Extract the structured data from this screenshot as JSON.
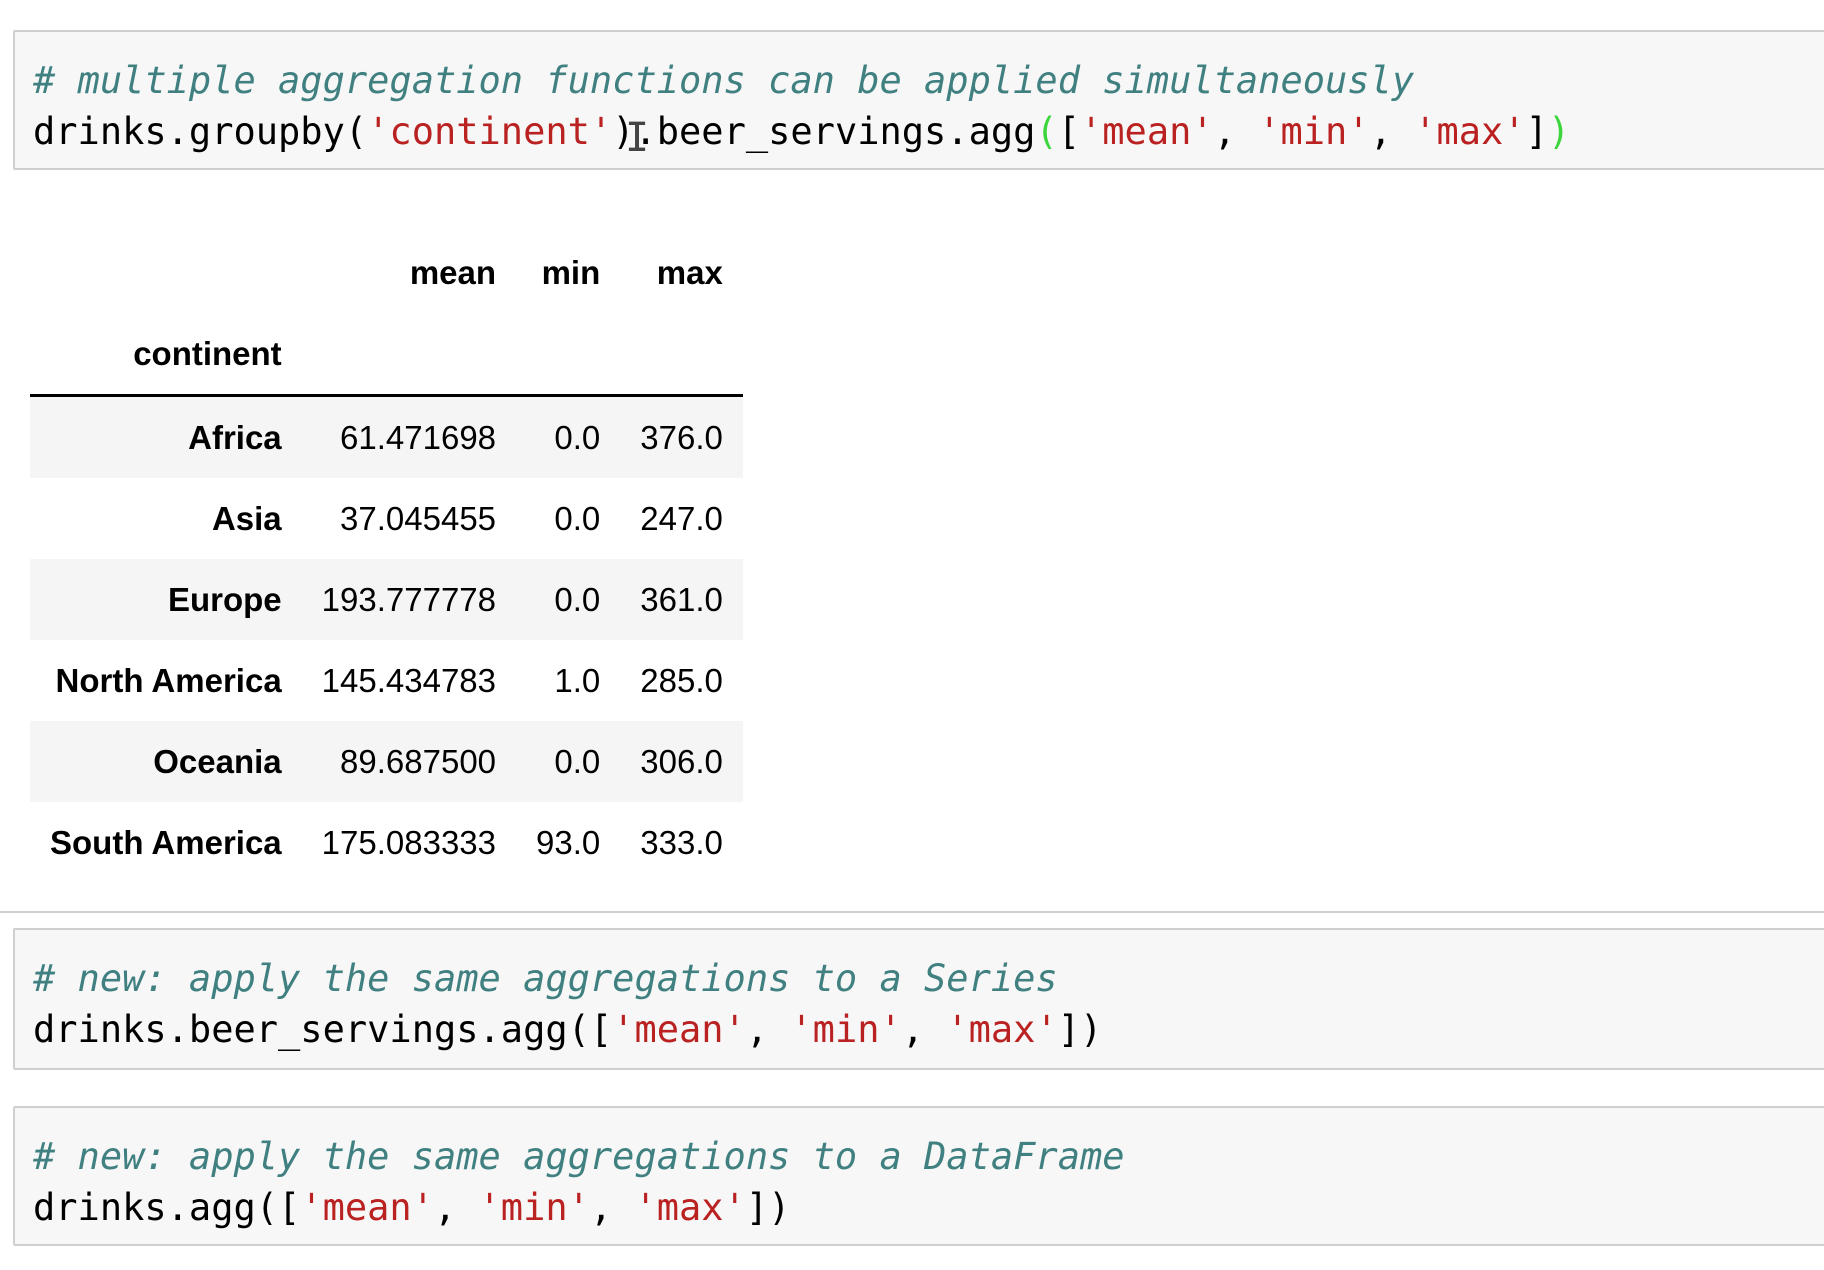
{
  "cells": [
    {
      "comment": "# multiple aggregation functions can be applied simultaneously",
      "code": {
        "p1": "drinks.groupby(",
        "s1": "'continent'",
        "p2": ").beer_servings.agg",
        "paren_open": "(",
        "p3": "[",
        "s2": "'mean'",
        "sep1": ", ",
        "s3": "'min'",
        "sep2": ", ",
        "s4": "'max'",
        "p4": "]",
        "paren_close": ")"
      }
    },
    {
      "comment": "# new: apply the same aggregations to a Series",
      "code": {
        "p1": "drinks.beer_servings.agg([",
        "s1": "'mean'",
        "sep1": ", ",
        "s2": "'min'",
        "sep2": ", ",
        "s3": "'max'",
        "p2": "])"
      }
    },
    {
      "comment": "# new: apply the same aggregations to a DataFrame",
      "code": {
        "p1": "drinks.agg([",
        "s1": "'mean'",
        "sep1": ", ",
        "s2": "'min'",
        "sep2": ", ",
        "s3": "'max'",
        "p2": "])"
      }
    }
  ],
  "output_table": {
    "columns": [
      "mean",
      "min",
      "max"
    ],
    "index_name": "continent",
    "rows": [
      {
        "label": "Africa",
        "values": [
          "61.471698",
          "0.0",
          "376.0"
        ]
      },
      {
        "label": "Asia",
        "values": [
          "37.045455",
          "0.0",
          "247.0"
        ]
      },
      {
        "label": "Europe",
        "values": [
          "193.777778",
          "0.0",
          "361.0"
        ]
      },
      {
        "label": "North America",
        "values": [
          "145.434783",
          "1.0",
          "285.0"
        ]
      },
      {
        "label": "Oceania",
        "values": [
          "89.687500",
          "0.0",
          "306.0"
        ]
      },
      {
        "label": "South America",
        "values": [
          "175.083333",
          "93.0",
          "333.0"
        ]
      }
    ]
  },
  "colors": {
    "comment": "#408080",
    "string": "#ba2121",
    "paren_match": "#3cd63c",
    "cell_bg": "#f7f7f7",
    "cell_border": "#cfcfcf"
  },
  "cursor_icon": "text-cursor-icon",
  "cursor_glyph": "I"
}
